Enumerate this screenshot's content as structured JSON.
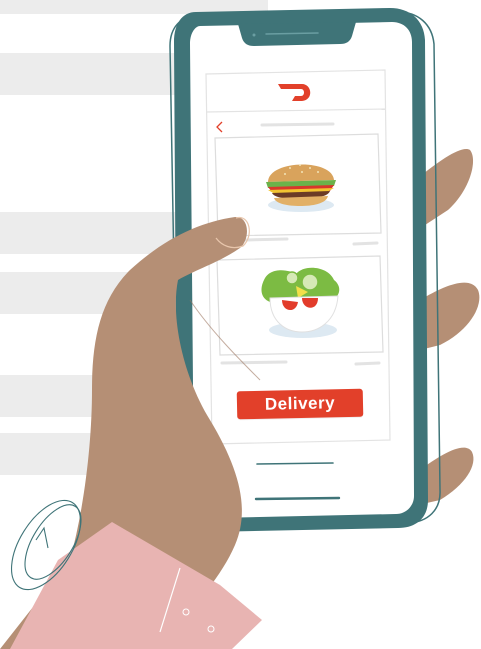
{
  "screen": {
    "back_icon": "chevron-left-icon",
    "logo_icon": "doordash-logo-icon",
    "food_items": [
      {
        "icon": "burger-icon"
      },
      {
        "icon": "salad-icon"
      }
    ],
    "delivery_button_label": "Delivery"
  },
  "colors": {
    "phone_frame": "#3f7478",
    "brand_red": "#e2402a",
    "skin": "#b58f75",
    "wristband": "#e8b4b2",
    "background_stripe": "#ececec"
  }
}
